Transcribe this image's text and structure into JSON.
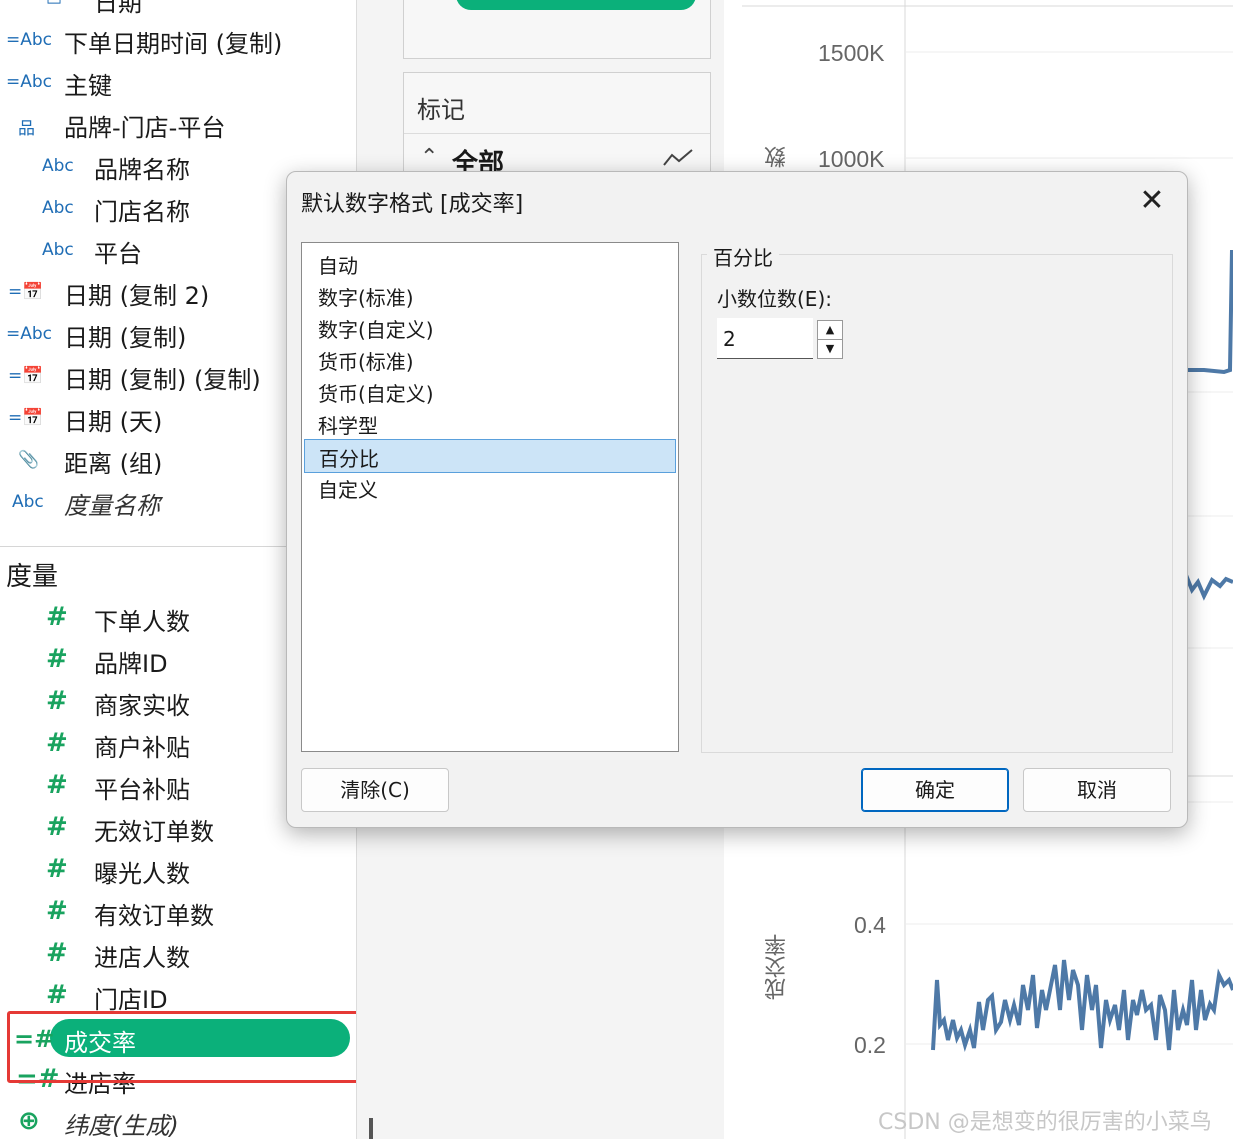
{
  "data_pane": {
    "top_partial": {
      "icon": "calendar-icon",
      "label": "日期"
    },
    "dimensions": [
      {
        "icon": "=Abc",
        "icon_name": "calculated-string-icon",
        "label": "下单日期时间 (复制)"
      },
      {
        "icon": "=Abc",
        "icon_name": "calculated-string-icon",
        "label": "主键"
      },
      {
        "icon": "品",
        "icon_name": "hierarchy-icon",
        "label": "品牌-门店-平台"
      },
      {
        "icon": "Abc",
        "icon_name": "string-icon",
        "label": "品牌名称"
      },
      {
        "icon": "Abc",
        "icon_name": "string-icon",
        "label": "门店名称"
      },
      {
        "icon": "Abc",
        "icon_name": "string-icon",
        "label": "平台"
      },
      {
        "icon": "=📅",
        "icon_name": "calculated-date-icon",
        "label": "日期 (复制 2)"
      },
      {
        "icon": "=Abc",
        "icon_name": "calculated-string-icon",
        "label": "日期 (复制)"
      },
      {
        "icon": "=📅",
        "icon_name": "calculated-date-icon",
        "label": "日期 (复制) (复制)"
      },
      {
        "icon": "=📅",
        "icon_name": "calculated-date-icon",
        "label": "日期 (天)"
      },
      {
        "icon": "📎",
        "icon_name": "group-paperclip-icon",
        "label": "距离 (组)"
      },
      {
        "icon": "Abc",
        "icon_name": "string-icon",
        "label": "度量名称"
      }
    ],
    "measures_header": "度量",
    "measures": [
      {
        "label": "下单人数"
      },
      {
        "label": "品牌ID"
      },
      {
        "label": "商家实收"
      },
      {
        "label": "商户补贴"
      },
      {
        "label": "平台补贴"
      },
      {
        "label": "无效订单数"
      },
      {
        "label": "曝光人数"
      },
      {
        "label": "有效订单数"
      },
      {
        "label": "进店人数"
      },
      {
        "label": "门店ID"
      },
      {
        "label": "成交率"
      },
      {
        "label": "进店率"
      },
      {
        "label": "纬度(生成)"
      }
    ]
  },
  "marks_card": {
    "title": "标记",
    "all_label": "全部"
  },
  "chart": {
    "top_ticks": [
      "1500K",
      "1000K"
    ],
    "top_axis_title_partial": "数",
    "bottom_ticks": [
      "0.4",
      "0.2"
    ],
    "bottom_axis_title": "成交率",
    "line_color": "#4e79a7"
  },
  "dialog": {
    "title": "默认数字格式 [成交率]",
    "close_symbol": "✕",
    "formats": [
      "自动",
      "数字(标准)",
      "数字(自定义)",
      "货币(标准)",
      "货币(自定义)",
      "科学型",
      "百分比",
      "自定义"
    ],
    "selected_format": "百分比",
    "group_title": "百分比",
    "decimals_label": "小数位数(E):",
    "decimals_value": "2",
    "clear_button": "清除(C)",
    "ok_button": "确定",
    "cancel_button": "取消"
  },
  "watermark": "CSDN @是想变的很厉害的小菜鸟"
}
